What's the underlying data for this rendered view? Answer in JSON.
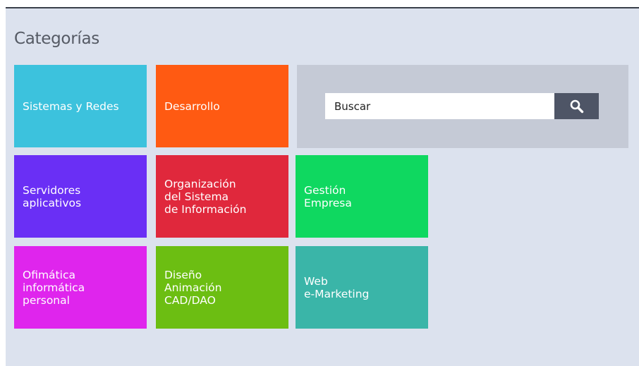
{
  "page": {
    "title": "Categorías"
  },
  "search": {
    "placeholder": "Buscar",
    "button_icon": "search-icon"
  },
  "tiles": [
    {
      "label": "Sistemas y Redes",
      "color": "#3cc2dd"
    },
    {
      "label": "Desarrollo",
      "color": "#ff5a12"
    },
    {
      "label": "Servidores\naplicativos",
      "color": "#6a2ff5"
    },
    {
      "label": "Organización\ndel Sistema\nde Información",
      "color": "#e0283c"
    },
    {
      "label": "Gestión\nEmpresa",
      "color": "#0fd860"
    },
    {
      "label": "Ofimática\ninformática\npersonal",
      "color": "#df25ed"
    },
    {
      "label": "Diseño\nAnimación\nCAD/DAO",
      "color": "#6cbe12"
    },
    {
      "label": "Web\ne-Marketing",
      "color": "#3ab5a8"
    }
  ]
}
